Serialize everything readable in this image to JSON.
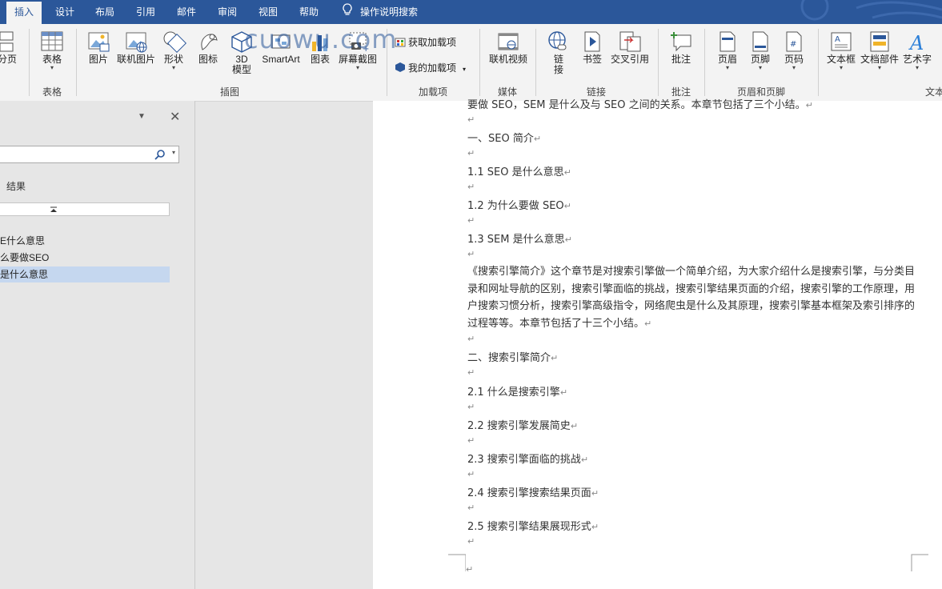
{
  "tabs": [
    {
      "label": "插入",
      "active": true
    },
    {
      "label": "设计"
    },
    {
      "label": "布局"
    },
    {
      "label": "引用"
    },
    {
      "label": "邮件"
    },
    {
      "label": "审阅"
    },
    {
      "label": "视图"
    },
    {
      "label": "帮助"
    }
  ],
  "tell_me": "操作说明搜索",
  "ribbon": {
    "pages_btn": "分页",
    "table_btn": "表格",
    "picture_btn": "图片",
    "online_picture_btn": "联机图片",
    "shapes_btn": "形状",
    "icons_btn": "图标",
    "model3d_btn": "3D\n模型",
    "smartart_btn": "SmartArt",
    "chart_btn": "图表",
    "screenshot_btn": "屏幕截图",
    "get_addins_btn": "获取加载项",
    "my_addins_btn": "我的加载项",
    "online_video_btn": "联机视频",
    "link_btn": "链\n接",
    "bookmark_btn": "书签",
    "crossref_btn": "交叉引用",
    "comment_btn": "批注",
    "header_btn": "页眉",
    "footer_btn": "页脚",
    "pagenum_btn": "页码",
    "textbox_btn": "文本框",
    "quickparts_btn": "文档部件",
    "wordart_btn": "艺术字",
    "group_tables": "表格",
    "group_illustrations": "插图",
    "group_addins": "加载项",
    "group_media": "媒体",
    "group_links": "链接",
    "group_comments": "批注",
    "group_header_footer": "页眉和页脚",
    "group_text": "文本"
  },
  "watermark": "cuowu.com",
  "nav": {
    "results_label": "结果",
    "items": [
      "E什么意思",
      "么要做SEO",
      "是什么意思"
    ]
  },
  "doc": {
    "top_partial": "要做 SEO，SEM 是什么及与 SEO 之间的关系。本章节包括了三个小结。",
    "lines": [
      "一、SEO 简介",
      "1.1 SEO 是什么意思",
      "1.2  为什么要做 SEO",
      "1.3 SEM 是什么意思"
    ],
    "paragraph": "《搜索引擎简介》这个章节是对搜索引擎做一个简单介绍，为大家介绍什么是搜索引擎，与分类目录和网址导航的区别，搜索引擎面临的挑战，搜索引擎结果页面的介绍，搜索引擎的工作原理，用户搜索习惯分析，搜索引擎高级指令，网络爬虫是什么及其原理，搜索引擎基本框架及索引排序的过程等等。本章节包括了十三个小结。",
    "lines2": [
      "二、搜索引擎简介",
      "2.1 什么是搜索引擎",
      "2.2 搜索引擎发展简史",
      "2.3 搜索引擎面临的挑战",
      "2.4 搜索引擎搜索结果页面",
      "2.5 搜索引擎结果展现形式"
    ]
  },
  "colors": {
    "accent": "#2b579a",
    "ribbon": "#f3f3f3",
    "nav_selected": "#c5d7ef"
  }
}
